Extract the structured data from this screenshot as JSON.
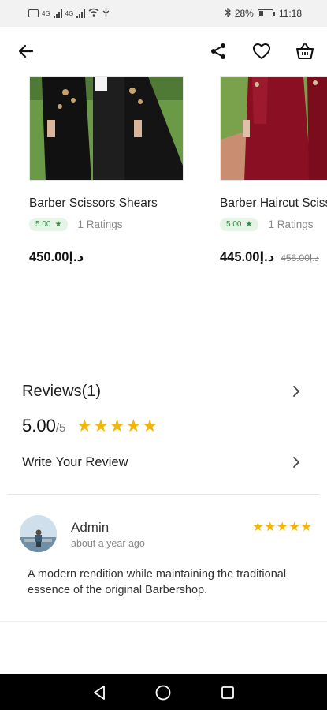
{
  "status_bar": {
    "battery": "28%",
    "time": "11:18",
    "icons": [
      "sim-icon",
      "signal-icon",
      "signal-icon",
      "wifi-icon",
      "usb-icon",
      "bluetooth-icon",
      "battery-icon"
    ]
  },
  "app_bar": {
    "icons": [
      "back-arrow-icon",
      "share-icon",
      "heart-icon",
      "basket-icon"
    ]
  },
  "products": [
    {
      "name": "Barber Scissors Shears",
      "rating": "5.00",
      "ratings_count": "1 Ratings",
      "price": "450.00د.إ",
      "old_price": ""
    },
    {
      "name": "Barber Haircut Scissors",
      "rating": "5.00",
      "ratings_count": "1 Ratings",
      "price": "445.00د.إ",
      "old_price": "456.00د.إ"
    }
  ],
  "reviews": {
    "title": "Reviews(1)",
    "score": "5.00",
    "score_max": "/5",
    "stars": "★★★★★",
    "write_label": "Write Your Review",
    "items": [
      {
        "author": "Admin",
        "time": "about a year ago",
        "stars": "★★★★★",
        "text": "A modern rendition while maintaining the traditional essence of the original Barbershop."
      }
    ]
  },
  "colors": {
    "star": "#f5b400",
    "badge_bg": "#e6f4e8",
    "badge_text": "#2e8b3e",
    "nav_bar": "#000000"
  },
  "nav_bar": {
    "icons": [
      "back-triangle-icon",
      "home-circle-icon",
      "recents-square-icon"
    ]
  }
}
